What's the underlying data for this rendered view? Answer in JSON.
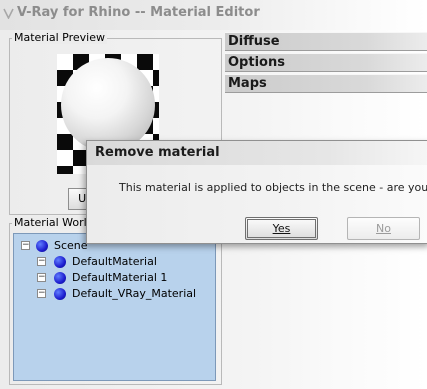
{
  "window": {
    "title": "V-Ray for Rhino -- Material Editor"
  },
  "preview": {
    "group_label": "Material Preview",
    "update_label": "Update"
  },
  "tree": {
    "group_label": "Material World",
    "root_label": "Scene",
    "items": [
      {
        "label": "DefaultMaterial"
      },
      {
        "label": "DefaultMaterial 1"
      },
      {
        "label": "Default_VRay_Material"
      }
    ]
  },
  "tabs": [
    {
      "label": "Diffuse"
    },
    {
      "label": "Options"
    },
    {
      "label": "Maps"
    }
  ],
  "dialog": {
    "title": "Remove material",
    "message": "This material is applied to objects in the scene - are you",
    "yes_label": "Yes",
    "no_label": "No"
  },
  "icons": {
    "window": "vray-logo-icon",
    "tree_item": "material-sphere-icon",
    "expander": "collapse-icon"
  },
  "colors": {
    "tree_background": "#b8d2ec",
    "material_icon": "#1d1dcf"
  }
}
